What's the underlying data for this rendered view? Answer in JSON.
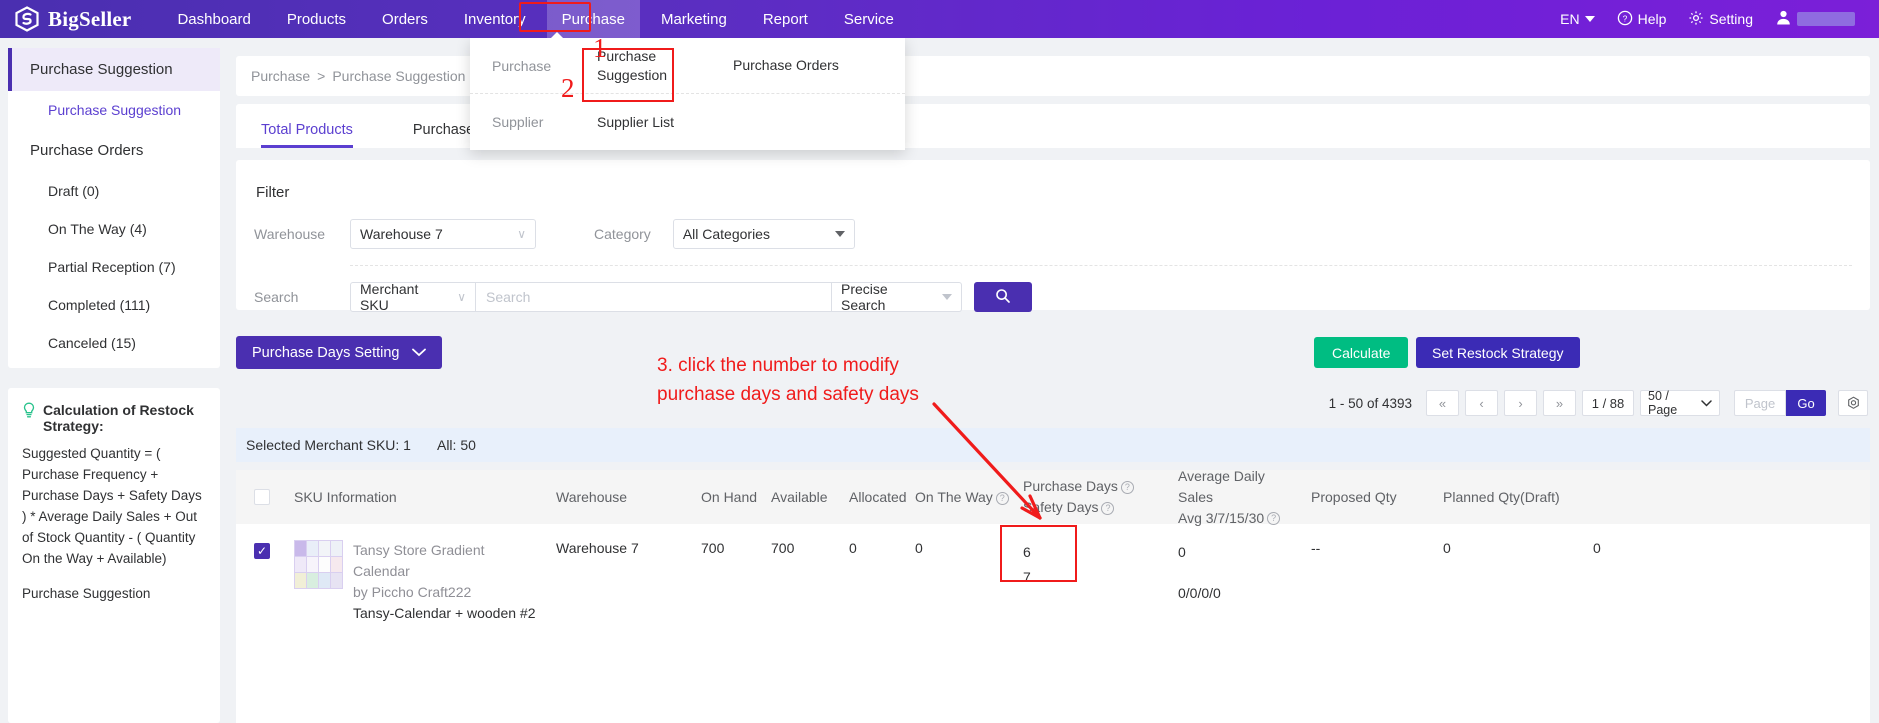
{
  "topnav": {
    "brand": "BigSeller",
    "logo_icon": "bigseller-logo-icon",
    "items": [
      {
        "label": "Dashboard",
        "active": false
      },
      {
        "label": "Products",
        "active": false
      },
      {
        "label": "Orders",
        "active": false
      },
      {
        "label": "Inventory",
        "active": false
      },
      {
        "label": "Purchase",
        "active": true
      },
      {
        "label": "Marketing",
        "active": false
      },
      {
        "label": "Report",
        "active": false
      },
      {
        "label": "Service",
        "active": false
      }
    ],
    "language": "EN",
    "help": "Help",
    "setting": "Setting",
    "help_icon": "question-circle-icon",
    "setting_icon": "gear-icon",
    "avatar_icon": "user-avatar-icon",
    "active_highlight_color": "#f01b1b"
  },
  "dropdown": {
    "group1_label": "Purchase",
    "group1_items": [
      "Purchase Suggestion",
      "Purchase Orders"
    ],
    "group2_label": "Supplier",
    "group2_items": [
      "Supplier List"
    ]
  },
  "annotations": {
    "num1": "1",
    "num2": "2",
    "step3_line1": "3. click the number to modify",
    "step3_line2": "purchase days and safety days",
    "color": "#f01b1b"
  },
  "sidebar": {
    "items": [
      {
        "label": "Purchase Suggestion",
        "type": "group",
        "selected": true
      },
      {
        "label": "Purchase Suggestion",
        "type": "sub",
        "active": true
      },
      {
        "label": "Purchase Orders",
        "type": "group",
        "selected": false
      },
      {
        "label": "Draft (0)",
        "type": "sub",
        "active": false
      },
      {
        "label": "On The Way (4)",
        "type": "sub",
        "active": false
      },
      {
        "label": "Partial Reception (7)",
        "type": "sub",
        "active": false
      },
      {
        "label": "Completed (111)",
        "type": "sub",
        "active": false
      },
      {
        "label": "Canceled (15)",
        "type": "sub",
        "active": false
      }
    ]
  },
  "tipbox": {
    "bulb_icon": "lightbulb-icon",
    "title": "Calculation of Restock Strategy:",
    "body": "Suggested Quantity = ( Purchase Frequency + Purchase Days + Safety Days ) * Average Daily Sales + Out of Stock Quantity - ( Quantity On the Way + Available)",
    "body2": "Purchase Suggestion"
  },
  "breadcrumb": {
    "items": [
      "Purchase",
      "Purchase Suggestion",
      ""
    ],
    "separator": ">"
  },
  "tabs": [
    {
      "label": "Total Products",
      "active": true
    },
    {
      "label": "Purchase Suggestion",
      "active": false
    }
  ],
  "filter": {
    "title": "Filter",
    "warehouse_label": "Warehouse",
    "warehouse_value": "Warehouse 7",
    "category_label": "Category",
    "category_value": "All Categories",
    "search_label": "Search",
    "search_type": "Merchant SKU",
    "search_placeholder": "Search",
    "precise_search": "Precise Search",
    "search_icon": "search-icon"
  },
  "actions": {
    "purchase_days_setting": "Purchase Days Setting",
    "chevron_icon": "chevron-down-icon",
    "calculate": "Calculate",
    "set_restock_strategy": "Set Restock Strategy",
    "calculate_color": "#00bd82",
    "restock_color": "#3b2bb5"
  },
  "pagination": {
    "count_text": "1 - 50 of 4393",
    "first_icon": "«",
    "prev_icon": "‹",
    "next_icon": "›",
    "last_icon": "»",
    "page_display": "1 / 88",
    "page_size": "50 / Page",
    "page_input_placeholder": "Page",
    "go_label": "Go",
    "settings_icon": "table-settings-icon"
  },
  "selection_banner": {
    "selected_text": "Selected Merchant SKU: 1",
    "all_text": "All: 50"
  },
  "table": {
    "columns": [
      {
        "label": "SKU Information",
        "help": false
      },
      {
        "label": "Warehouse",
        "help": false
      },
      {
        "label": "On Hand",
        "help": false
      },
      {
        "label": "Available",
        "help": false
      },
      {
        "label": "Allocated",
        "help": false
      },
      {
        "label": "On The Way",
        "help": true
      },
      {
        "label": "Purchase Days",
        "label2": "Safety Days",
        "help": true,
        "help2": true
      },
      {
        "label": "Average Daily Sales",
        "label2": "Avg 3/7/15/30",
        "help2": true
      },
      {
        "label": "Proposed Qty",
        "help": false
      },
      {
        "label": "Planned Qty(Draft)",
        "help": false
      }
    ],
    "rows": [
      {
        "checked": true,
        "sku_name_line1": "Tansy Store Gradient Calendar",
        "sku_name_line2": "by Piccho Craft222",
        "sku_code": "Tansy-Calendar + wooden #2",
        "warehouse": "Warehouse 7",
        "on_hand": "700",
        "available": "700",
        "allocated": "0",
        "on_the_way": "0",
        "purchase_days": "6",
        "safety_days": "7",
        "avg_daily_sales": "0",
        "avg_breakdown": "0/0/0/0",
        "proposed_qty": "--",
        "planned_qty": "0",
        "trailing": "0"
      }
    ]
  }
}
